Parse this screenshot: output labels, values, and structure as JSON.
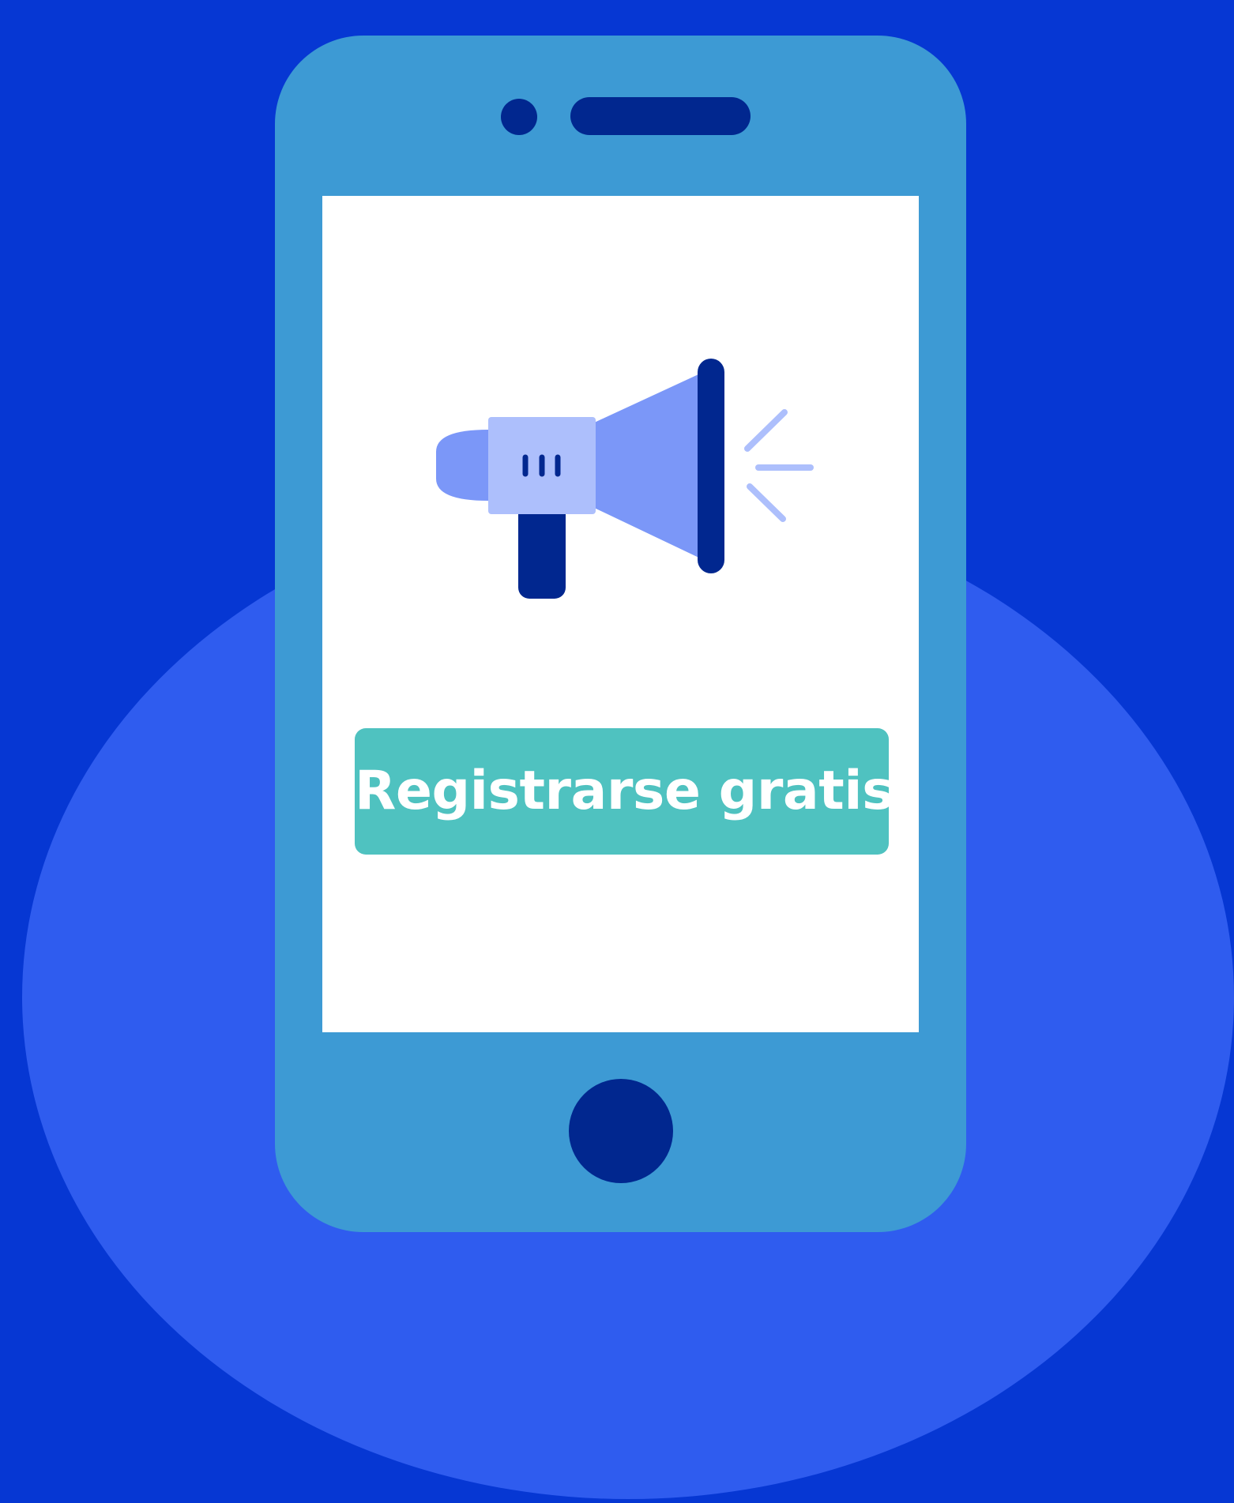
{
  "cta": {
    "label": "Registrarse gratis"
  },
  "icons": {
    "illustration": "megaphone-icon"
  },
  "colors": {
    "background": "#0637d3",
    "ellipse": "#2f5cef",
    "phone_body": "#3d9ad4",
    "phone_details": "#01278f",
    "screen": "#ffffff",
    "button": "#4fc2c0",
    "button_text": "#ffffff",
    "megaphone_cone": "#7b97f8",
    "megaphone_body": "#adbffc",
    "megaphone_rays": "#adbffc"
  }
}
